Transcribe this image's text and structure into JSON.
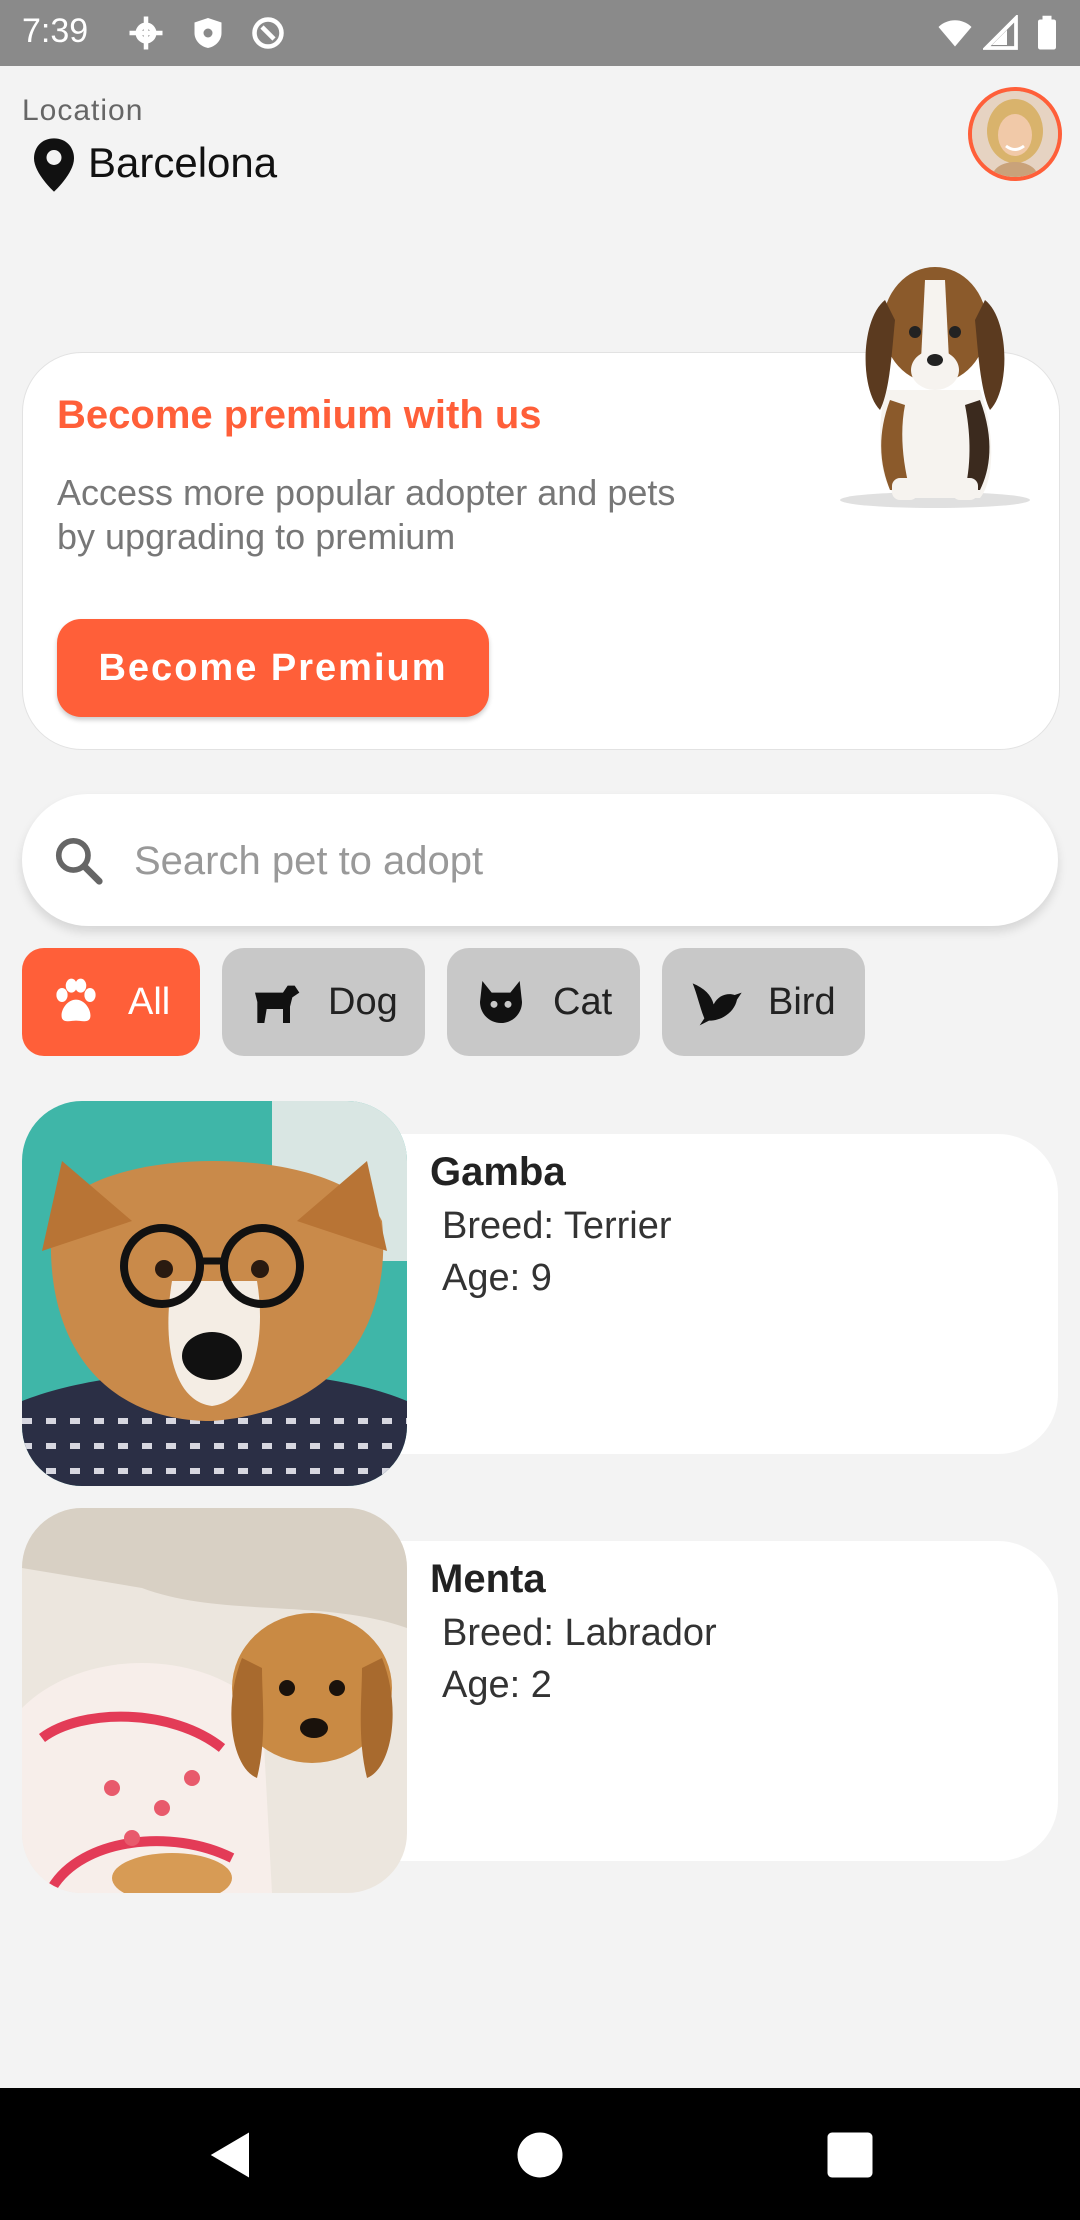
{
  "status_bar": {
    "time": "7:39"
  },
  "location": {
    "label": "Location",
    "city": "Barcelona"
  },
  "premium": {
    "title": "Become premium with us",
    "description": "Access more popular adopter and pets by upgrading to premium",
    "button_label": "Become Premium"
  },
  "search": {
    "placeholder": "Search pet to adopt"
  },
  "categories": [
    {
      "label": "All",
      "icon": "paw-icon",
      "active": true
    },
    {
      "label": "Dog",
      "icon": "dog-icon",
      "active": false
    },
    {
      "label": "Cat",
      "icon": "cat-icon",
      "active": false
    },
    {
      "label": "Bird",
      "icon": "bird-icon",
      "active": false
    }
  ],
  "pets": [
    {
      "name": "Gamba",
      "breed": "Breed: Terrier",
      "age": "Age: 9"
    },
    {
      "name": "Menta",
      "breed": "Breed: Labrador",
      "age": "Age: 2"
    }
  ],
  "colors": {
    "accent": "#ff5f39",
    "background": "#f3f3f3",
    "chip_inactive": "#c8c8c8"
  }
}
